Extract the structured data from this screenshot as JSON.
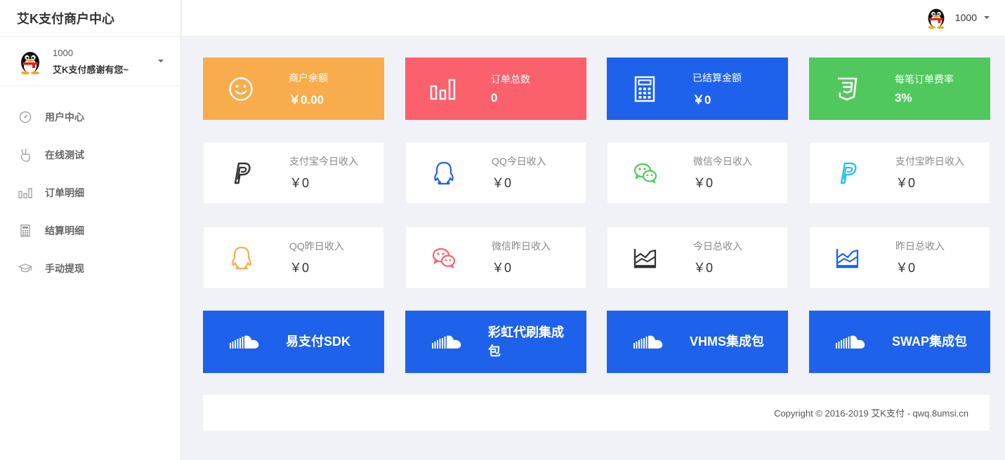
{
  "sidebar": {
    "brand": "艾K支付商户中心",
    "user": {
      "id": "1000",
      "greeting": "艾K支付感谢有您~"
    },
    "items": [
      {
        "label": "用户中心",
        "icon": "dashboard-icon"
      },
      {
        "label": "在线测试",
        "icon": "hand-peace-icon"
      },
      {
        "label": "订单明细",
        "icon": "bar-chart-icon"
      },
      {
        "label": "结算明细",
        "icon": "calculator-icon"
      },
      {
        "label": "手动提现",
        "icon": "graduation-cap-icon"
      }
    ]
  },
  "topbar": {
    "username": "1000"
  },
  "stats": [
    {
      "label": "商户余额",
      "value": "￥0.00",
      "color": "#f9ac4b",
      "icon": "smile-icon"
    },
    {
      "label": "订单总数",
      "value": "0",
      "color": "#fb616c",
      "icon": "bar-chart-icon"
    },
    {
      "label": "已结算金额",
      "value": "￥0",
      "color": "#1e62ec",
      "icon": "calculator-icon"
    },
    {
      "label": "每笔订单费率",
      "value": "3%",
      "color": "#51c85e",
      "icon": "css3-icon"
    }
  ],
  "income_today": [
    {
      "label": "支付宝今日收入",
      "value": "￥0",
      "icon": "paypal-icon",
      "color": "#333333"
    },
    {
      "label": "QQ今日收入",
      "value": "￥0",
      "icon": "qq-icon",
      "color": "#1e62ec"
    },
    {
      "label": "微信今日收入",
      "value": "￥0",
      "icon": "wechat-icon",
      "color": "#51c85e"
    },
    {
      "label": "支付宝昨日收入",
      "value": "￥0",
      "icon": "paypal-icon",
      "color": "#2cc0e6"
    }
  ],
  "income_yesterday": [
    {
      "label": "QQ昨日收入",
      "value": "￥0",
      "icon": "qq-icon",
      "color": "#f9ac4b"
    },
    {
      "label": "微信昨日收入",
      "value": "￥0",
      "icon": "wechat-icon",
      "color": "#fb616c"
    },
    {
      "label": "今日总收入",
      "value": "￥0",
      "icon": "area-chart-icon",
      "color": "#333333"
    },
    {
      "label": "昨日总收入",
      "value": "￥0",
      "icon": "area-chart-icon",
      "color": "#1e62ec"
    }
  ],
  "sdks": [
    {
      "label": "易支付SDK",
      "icon": "cloud-icon"
    },
    {
      "label": "彩虹代刷集成包",
      "icon": "cloud-icon"
    },
    {
      "label": "VHMS集成包",
      "icon": "cloud-icon"
    },
    {
      "label": "SWAP集成包",
      "icon": "cloud-icon"
    }
  ],
  "footer": {
    "copyright": "Copyright © 2016-2019 艾K支付 - qwq.8umsi.cn"
  }
}
